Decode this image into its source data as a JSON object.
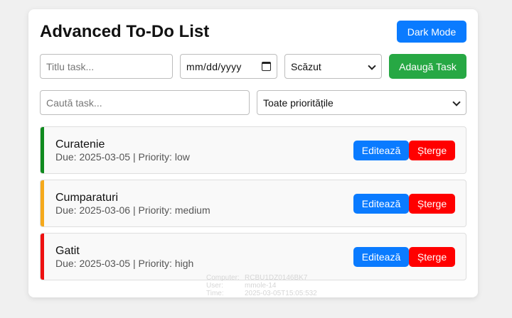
{
  "header": {
    "title": "Advanced To-Do List",
    "dark_mode_label": "Dark Mode"
  },
  "add_form": {
    "title_placeholder": "Titlu task...",
    "date_placeholder": "mm/dd/yyyy",
    "priority_selected": "Scăzut",
    "add_label": "Adaugă Task"
  },
  "filters": {
    "search_placeholder": "Caută task...",
    "priority_filter_selected": "Toate prioritățile"
  },
  "tasks": [
    {
      "name": "Curatenie",
      "meta": "Due: 2025-03-05 | Priority: low",
      "priority_color": "#0f8a1e",
      "edit_label": "Editează",
      "delete_label": "Șterge"
    },
    {
      "name": "Cumparaturi",
      "meta": "Due: 2025-03-06 | Priority: medium",
      "priority_color": "#f5a91c",
      "edit_label": "Editează",
      "delete_label": "Șterge"
    },
    {
      "name": "Gatit",
      "meta": "Due: 2025-03-05 | Priority: high",
      "priority_color": "#ee1111",
      "edit_label": "Editează",
      "delete_label": "Șterge"
    }
  ],
  "colors": {
    "accent_blue": "#0a7bff",
    "add_green": "#27a844",
    "delete_red": "#ff0000"
  },
  "watermark": {
    "computer_label": "Computer:",
    "computer_value": "RCBU1DZ0146BK7",
    "user_label": "User:",
    "user_value": "mmole-14",
    "time_label": "Time:",
    "time_value": "2025-03-05T15:05:532"
  }
}
